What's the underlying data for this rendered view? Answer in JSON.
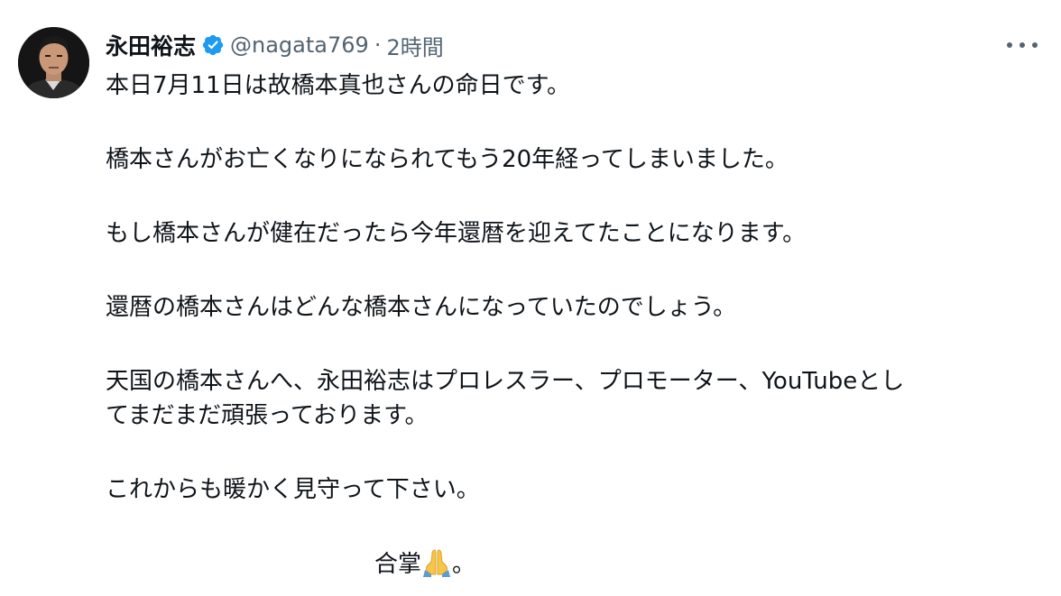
{
  "author": {
    "display_name": "永田裕志",
    "handle": "@nagata769",
    "separator": "·",
    "timestamp": "2時間",
    "verified": true
  },
  "icons": {
    "verified": "verified-badge-icon",
    "more": "more-options-icon",
    "pray": "folded-hands-emoji"
  },
  "colors": {
    "verified_blue": "#1d9bf0",
    "secondary_text": "#536471",
    "primary_text": "#0f1419"
  },
  "tweet": {
    "line1": "本日7月11日は故橋本真也さんの命日です。",
    "line2": "橋本さんがお亡くなりになられてもう20年経ってしまいました。",
    "line3": "もし橋本さんが健在だったら今年還暦を迎えてたことになります。",
    "line4": "還暦の橋本さんはどんな橋本さんになっていたのでしょう。",
    "line5a": "天国の橋本さんへ、永田裕志はプロレスラー、プロモーター、YouTubeとし",
    "line5b": "てまだまだ頑張っております。",
    "line6": "これからも暖かく見守って下さい。",
    "closing": "合掌",
    "closing_end": "。"
  }
}
